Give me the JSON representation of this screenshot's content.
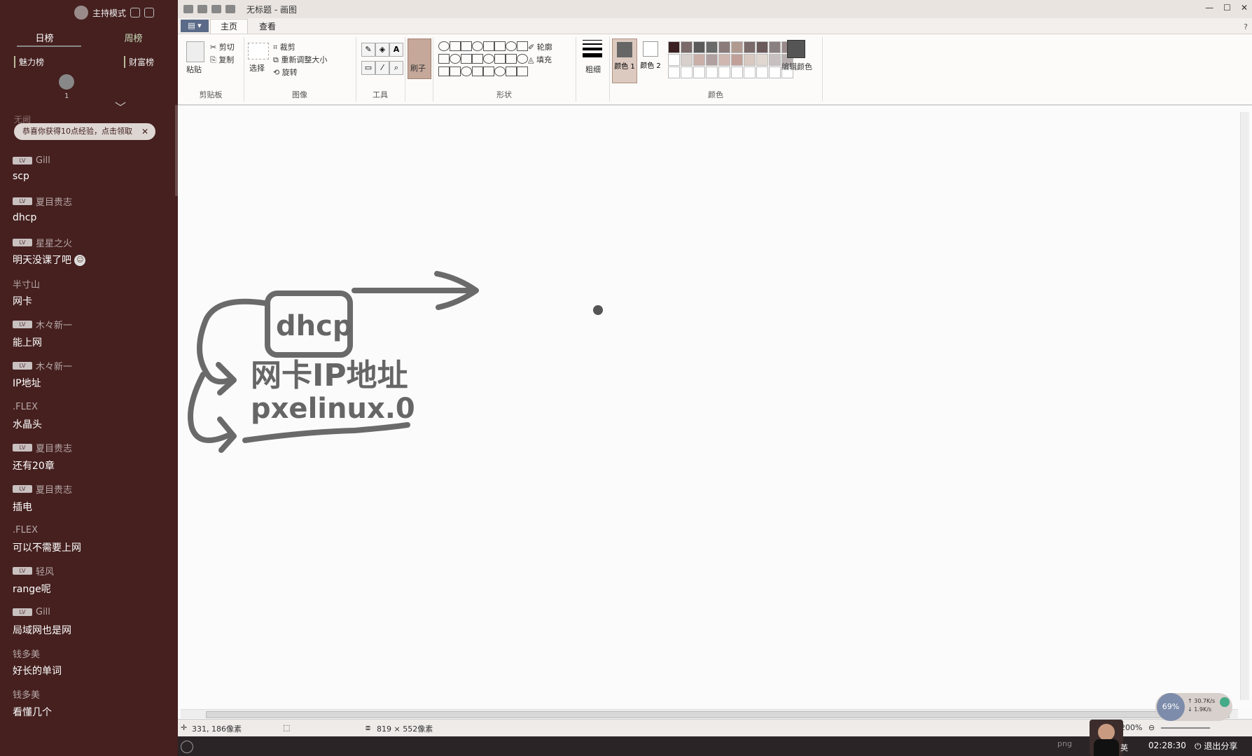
{
  "left_panel": {
    "host_mode": "主持模式",
    "rank_tabs": [
      "日榜",
      "周榜"
    ],
    "sub_tabs": [
      "魅力榜",
      "财富榜"
    ],
    "avatar_count": "1",
    "toast_text": "恭喜你获得10点经验，点击领取",
    "toast_under": "无阙",
    "messages": [
      {
        "user": "Gill",
        "badge": "LV",
        "text": "scp"
      },
      {
        "user": "夏目贵志",
        "badge": "LV",
        "text": "dhcp"
      },
      {
        "user": "星星之火",
        "badge": "LV",
        "text": "明天没课了吧"
      },
      {
        "user": "半寸山",
        "badge": "",
        "text": "网卡"
      },
      {
        "user": "木々新一",
        "badge": "LV",
        "text": "能上网"
      },
      {
        "user": "木々新一",
        "badge": "LV",
        "text": "IP地址"
      },
      {
        "user": ".FLEX",
        "badge": "",
        "text": "水晶头"
      },
      {
        "user": "夏目贵志",
        "badge": "LV",
        "text": "还有20章"
      },
      {
        "user": "夏目贵志",
        "badge": "LV",
        "text": "插电"
      },
      {
        "user": ".FLEX",
        "badge": "",
        "text": "可以不需要上网"
      },
      {
        "user": "轻风",
        "badge": "LV",
        "text": "range呢"
      },
      {
        "user": "Gill",
        "badge": "LV",
        "text": "局域网也是网"
      },
      {
        "user": "钱多美",
        "badge": "",
        "text": "好长的单词"
      },
      {
        "user": "钱多美",
        "badge": "",
        "text": "看懂几个"
      }
    ]
  },
  "paint": {
    "title": "无标题 - 画图",
    "file_button": "▤ ▾",
    "tabs": [
      "主页",
      "查看"
    ],
    "window_controls": [
      "—",
      "☐",
      "✕"
    ],
    "ribbon": {
      "clipboard": {
        "paste": "粘贴",
        "cut": "剪切",
        "copy": "复制",
        "label": "剪贴板"
      },
      "image": {
        "select": "选择",
        "crop": "裁剪",
        "resize": "重新调整大小",
        "rotate": "旋转",
        "label": "图像"
      },
      "tools": {
        "label": "工具"
      },
      "brush": {
        "label": "刷子"
      },
      "shapes": {
        "outline": "轮廓",
        "fill": "填充",
        "label": "形状"
      },
      "size": {
        "label": "粗细"
      },
      "colors": {
        "color1": "颜色 1",
        "color2": "颜色 2",
        "edit": "编辑颜色",
        "label": "颜色"
      }
    },
    "canvas_text": {
      "box": "dhcp",
      "line1": "网卡IP地址",
      "line2": "pxelinux.0"
    },
    "status": {
      "cursor": "331, 186像素",
      "size": "819 × 552像素",
      "zoom": "200%"
    }
  },
  "overlay": {
    "net_percent": "69%",
    "up_speed": "↑ 30.7K/s",
    "down_speed": "↓ 1.9K/s",
    "ime": "英",
    "clock": "02:28:30",
    "exit_share": "退出分享",
    "png": "png"
  },
  "colors": {
    "panel_bg": "#45201f",
    "canvas_ink": "#6a6a6a",
    "ribbon_accent": "#5b6a88"
  }
}
